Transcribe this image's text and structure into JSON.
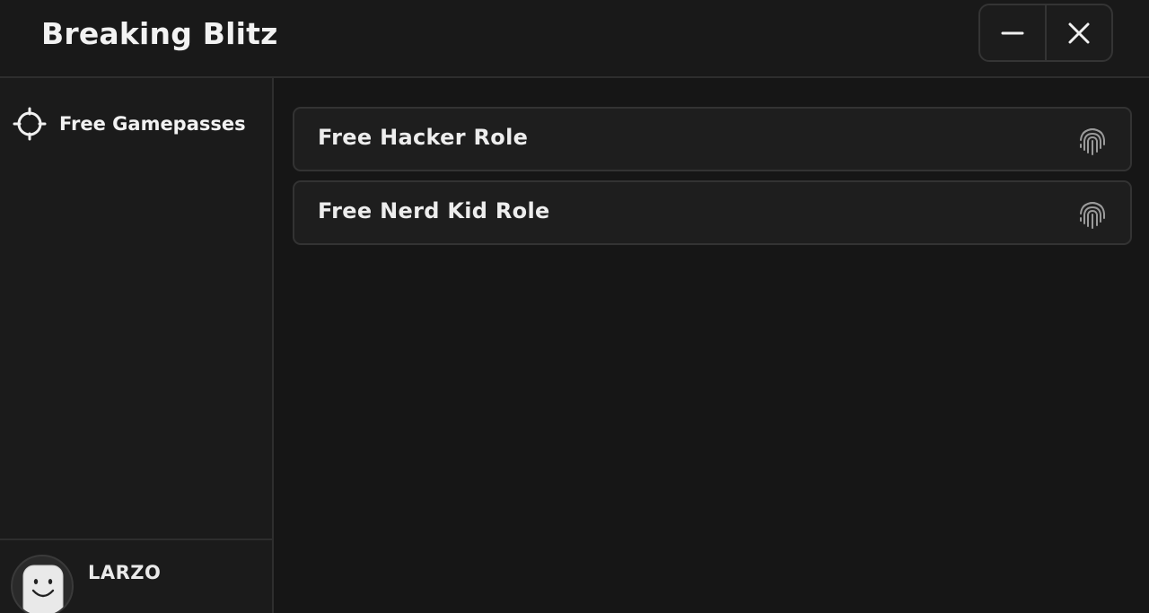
{
  "window": {
    "title": "Breaking Blitz",
    "minimize_icon": "minus-icon",
    "close_icon": "close-icon"
  },
  "sidebar": {
    "items": [
      {
        "label": "Free Gamepasses",
        "icon": "crosshair-icon"
      }
    ],
    "profile": {
      "username": "LARZO",
      "avatar_icon": "smiley-avatar-icon"
    }
  },
  "main": {
    "buttons": [
      {
        "label": "Free Hacker Role",
        "icon": "fingerprint-icon"
      },
      {
        "label": "Free Nerd Kid Role",
        "icon": "fingerprint-icon"
      }
    ]
  },
  "colors": {
    "background": "#181818",
    "panel": "#1e1e1e",
    "border": "#333333",
    "text": "#ededed"
  }
}
